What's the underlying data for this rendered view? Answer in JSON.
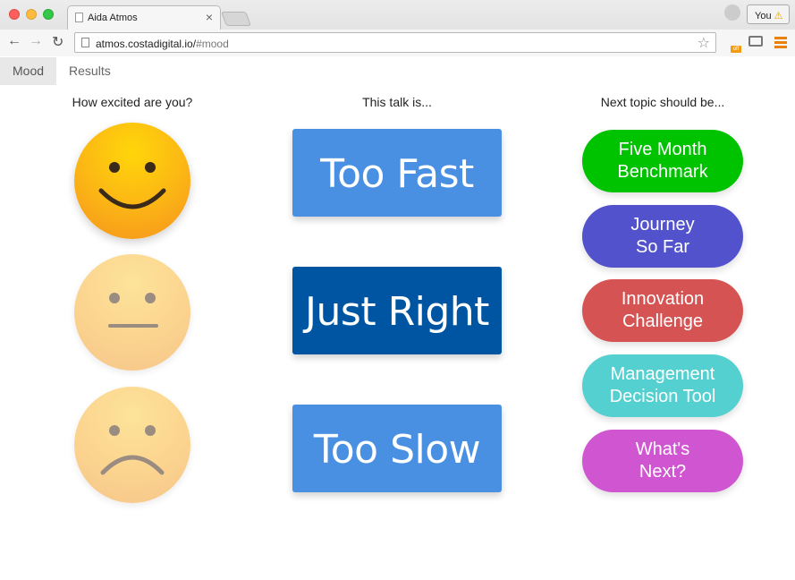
{
  "browser": {
    "tab_title": "Aida Atmos",
    "tab_close": "×",
    "profile_label": "You",
    "profile_warning": "⚠",
    "url_host": "atmos.costadigital.io/",
    "url_path": "#mood",
    "back_glyph": "←",
    "forward_glyph": "→",
    "reload_glyph": "↻",
    "star_glyph": "☆",
    "ext_badge": "off"
  },
  "nav": {
    "tabs": [
      {
        "label": "Mood",
        "active": true
      },
      {
        "label": "Results",
        "active": false
      }
    ]
  },
  "columns": {
    "excitement_heading": "How excited are you?",
    "pace_heading": "This talk is...",
    "topic_heading": "Next topic should be..."
  },
  "faces": [
    {
      "name": "happy",
      "icon": "happy-face-icon",
      "selected": true
    },
    {
      "name": "neutral",
      "icon": "neutral-face-icon",
      "selected": false
    },
    {
      "name": "sad",
      "icon": "sad-face-icon",
      "selected": false
    }
  ],
  "pace": {
    "fast": "Too Fast",
    "right": "Just Right",
    "slow": "Too Slow"
  },
  "topics": [
    {
      "line1": "Five Month",
      "line2": "Benchmark",
      "color": "#00c300"
    },
    {
      "line1": "Journey",
      "line2": "So Far",
      "color": "#5252cc"
    },
    {
      "line1": "Innovation",
      "line2": "Challenge",
      "color": "#d65353"
    },
    {
      "line1": "Management",
      "line2": "Decision Tool",
      "color": "#55d0d0"
    },
    {
      "line1": "What's",
      "line2": "Next?",
      "color": "#d055d0"
    }
  ],
  "colors": {
    "pace_default": "#4a90e2",
    "pace_selected": "#0055a2"
  }
}
